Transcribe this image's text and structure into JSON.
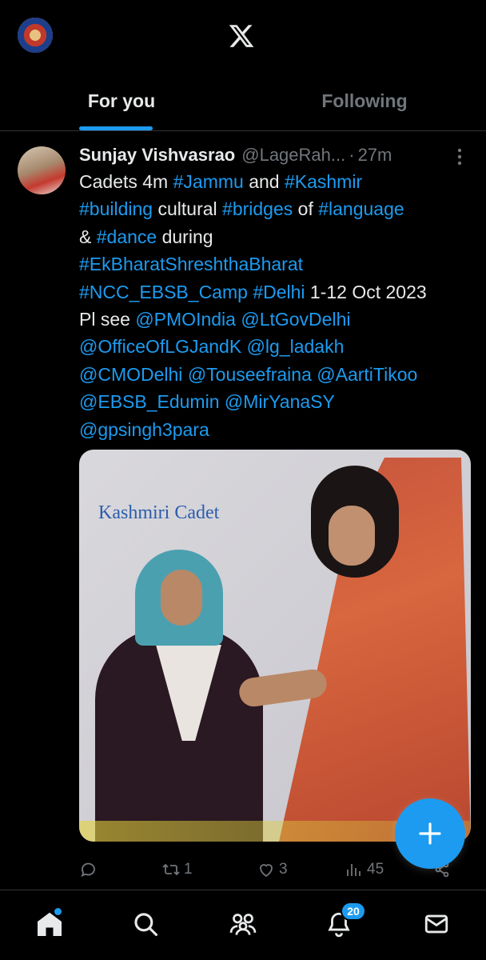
{
  "header": {
    "logo_icon": "x-logo-icon",
    "avatar_icon": "profile-avatar"
  },
  "tabs": [
    {
      "label": "For you",
      "active": true
    },
    {
      "label": "Following",
      "active": false
    }
  ],
  "tweet": {
    "author_name": "Sunjay Vishvasrao",
    "handle": "@LageRah...",
    "separator": "·",
    "time": "27m",
    "text_lines": [
      [
        {
          "t": "Cadets 4m ",
          "link": false
        },
        {
          "t": "#Jammu",
          "link": true
        },
        {
          "t": " and ",
          "link": false
        },
        {
          "t": "#Kashmir",
          "link": true
        }
      ],
      [
        {
          "t": "#building",
          "link": true
        },
        {
          "t": " cultural ",
          "link": false
        },
        {
          "t": "#bridges",
          "link": true
        },
        {
          "t": " of ",
          "link": false
        },
        {
          "t": "#language",
          "link": true
        }
      ],
      [
        {
          "t": "& ",
          "link": false
        },
        {
          "t": "#dance",
          "link": true
        },
        {
          "t": " during",
          "link": false
        }
      ],
      [
        {
          "t": "#EkBharatShreshthaBharat",
          "link": true
        }
      ],
      [
        {
          "t": "#NCC_EBSB_Camp",
          "link": true
        },
        {
          "t": " ",
          "link": false
        },
        {
          "t": "#Delhi",
          "link": true
        },
        {
          "t": " 1-12 Oct 2023",
          "link": false
        }
      ],
      [
        {
          "t": "Pl see ",
          "link": false
        },
        {
          "t": "@PMOIndia",
          "link": true
        },
        {
          "t": " ",
          "link": false
        },
        {
          "t": "@LtGovDelhi",
          "link": true
        }
      ],
      [
        {
          "t": "@OfficeOfLGJandK",
          "link": true
        },
        {
          "t": " ",
          "link": false
        },
        {
          "t": "@lg_ladakh",
          "link": true
        }
      ],
      [
        {
          "t": "@CMODelhi",
          "link": true
        },
        {
          "t": " ",
          "link": false
        },
        {
          "t": "@Touseefraina",
          "link": true
        },
        {
          "t": " ",
          "link": false
        },
        {
          "t": "@AartiTikoo",
          "link": true
        }
      ],
      [
        {
          "t": "@EBSB_Edumin",
          "link": true
        },
        {
          "t": " ",
          "link": false
        },
        {
          "t": "@MirYanaSY",
          "link": true
        }
      ],
      [
        {
          "t": "@gpsingh3para",
          "link": true
        }
      ]
    ],
    "media_caption": "Kashmiri Cadet",
    "actions": {
      "reply_count": "",
      "repost_count": "1",
      "like_count": "3",
      "views_count": "45"
    }
  },
  "bottom_nav": {
    "items": [
      "home-icon",
      "search-icon",
      "communities-icon",
      "notifications-icon",
      "messages-icon"
    ],
    "notifications_badge": "20"
  },
  "colors": {
    "accent": "#1d9bf0",
    "background": "#000000",
    "muted": "#71767b",
    "text": "#e7e9ea"
  }
}
